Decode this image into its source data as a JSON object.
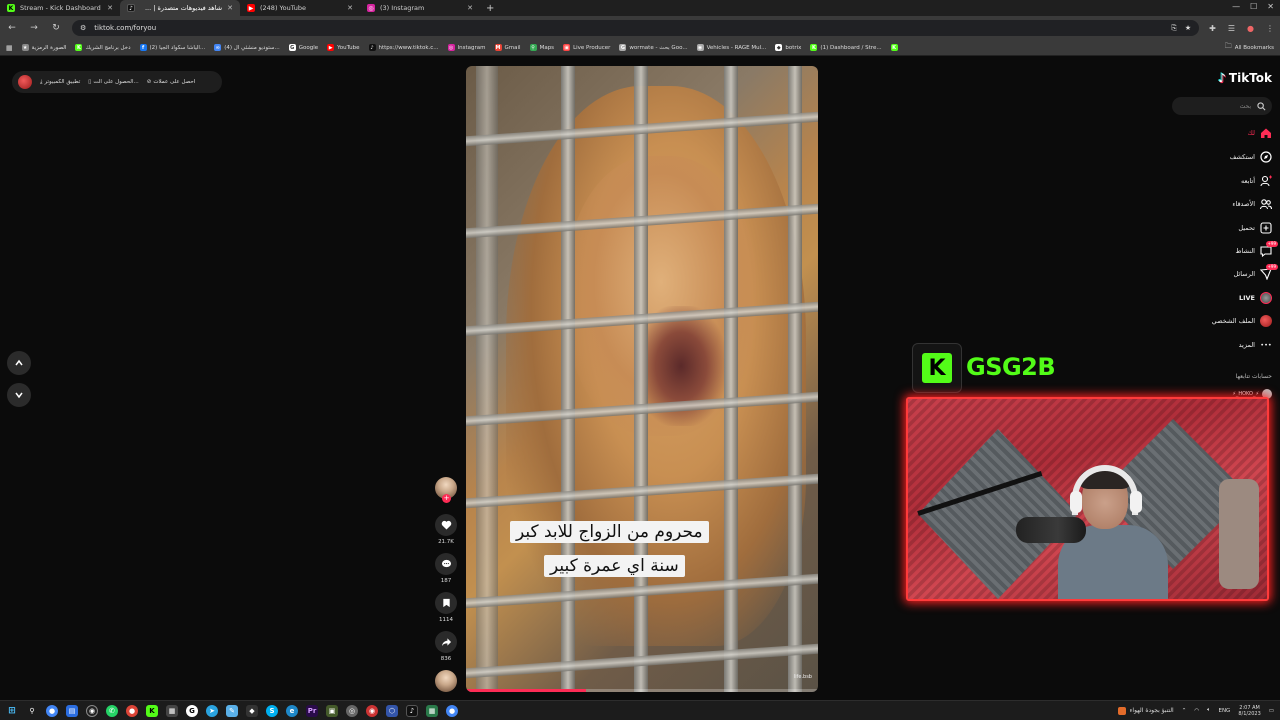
{
  "browser": {
    "tabs": [
      {
        "title": "Stream - Kick Dashboard",
        "favicon": "kick-icon",
        "color": "#53fc18",
        "glyph": "K"
      },
      {
        "title": "شاهد فيديوهات متصدرة | ...",
        "favicon": "tiktok-icon",
        "color": "#111111",
        "glyph": "♪",
        "active": true
      },
      {
        "title": "(248) YouTube",
        "favicon": "youtube-icon",
        "color": "#ff0000",
        "glyph": "▶"
      },
      {
        "title": "(3) Instagram",
        "favicon": "instagram-icon",
        "color": "#d6249f",
        "glyph": "◎"
      }
    ],
    "new_tab": "+",
    "url": "tiktok.com/foryou",
    "bookmarks": [
      {
        "label": "الصورة الرمزية",
        "color": "#888888",
        "glyph": "★"
      },
      {
        "label": "دخل برنامج الشريك",
        "color": "#53fc18",
        "glyph": "K"
      },
      {
        "label": "(2) الياشا سكواد الجيا...",
        "color": "#1877f2",
        "glyph": "f"
      },
      {
        "label": "(4) ستوديو منشئي ال...",
        "color": "#4285f4",
        "glyph": "∞"
      },
      {
        "label": "Google",
        "color": "#ffffff",
        "glyph": "G"
      },
      {
        "label": "YouTube",
        "color": "#ff0000",
        "glyph": "▶"
      },
      {
        "label": "https://www.tiktok.c...",
        "color": "#111111",
        "glyph": "♪"
      },
      {
        "label": "Instagram",
        "color": "#d6249f",
        "glyph": "◎"
      },
      {
        "label": "Gmail",
        "color": "#ea4335",
        "glyph": "M"
      },
      {
        "label": "Maps",
        "color": "#34a853",
        "glyph": "⚲"
      },
      {
        "label": "Live Producer",
        "color": "#ff4444",
        "glyph": "▣"
      },
      {
        "label": "wormate - بحث Goo...",
        "color": "#aaaaaa",
        "glyph": "G"
      },
      {
        "label": "Vehicles - RAGE Mul...",
        "color": "#aaaaaa",
        "glyph": "◉"
      },
      {
        "label": "botrix",
        "color": "#ffffff",
        "glyph": "◆"
      },
      {
        "label": "(1) Dashboard / Stre...",
        "color": "#53fc18",
        "glyph": "K"
      },
      {
        "label": "",
        "color": "#53fc18",
        "glyph": "K"
      }
    ],
    "all_bookmarks": "All Bookmarks"
  },
  "promo": {
    "get_coins": "احصل على عملات",
    "get_app": "الحصول على الت...",
    "desktop_app": "تطبيق الكمبيوتر"
  },
  "video": {
    "caption_line1": "محروم من الزواج للابد كبر",
    "caption_line2": "سنة اي عمرة كبير",
    "watermark": "life.bsb",
    "progress_fraction": 0.34
  },
  "actions": {
    "likes": "21.7K",
    "comments": "187",
    "saves": "1114",
    "shares": "836",
    "follow": "+"
  },
  "tiktok_nav": {
    "logo": "TikTok",
    "search_placeholder": "بحث",
    "items": [
      {
        "label": "لك",
        "icon": "home-icon",
        "active": true
      },
      {
        "label": "استكشف",
        "icon": "compass-icon"
      },
      {
        "label": "أتابعه",
        "icon": "following-icon"
      },
      {
        "label": "الأصدقاء",
        "icon": "friends-icon"
      },
      {
        "label": "تحميل",
        "icon": "upload-icon"
      },
      {
        "label": "النشاط",
        "icon": "activity-icon",
        "badge": "99+"
      },
      {
        "label": "الرسائل",
        "icon": "messages-icon",
        "badge": "99+"
      },
      {
        "label": "LIVE",
        "icon": "live-icon"
      },
      {
        "label": "الملف الشخصي",
        "icon": "profile-icon"
      },
      {
        "label": "المزيد",
        "icon": "more-icon"
      }
    ],
    "following_title": "حسابات تتابعها",
    "following_account": "⚡_HOKO_⚡"
  },
  "stream": {
    "channel_name": "GSG2B",
    "logo_glyph": "K"
  },
  "taskbar": {
    "weather_text": "التنبؤ بجودة الهواء",
    "language": "ENG",
    "time": "2:07 AM",
    "date": "8/1/2023"
  },
  "colors": {
    "tiktok_red": "#fe2c55",
    "kick_green": "#53fc18",
    "cam_border": "#ff3b3b"
  }
}
